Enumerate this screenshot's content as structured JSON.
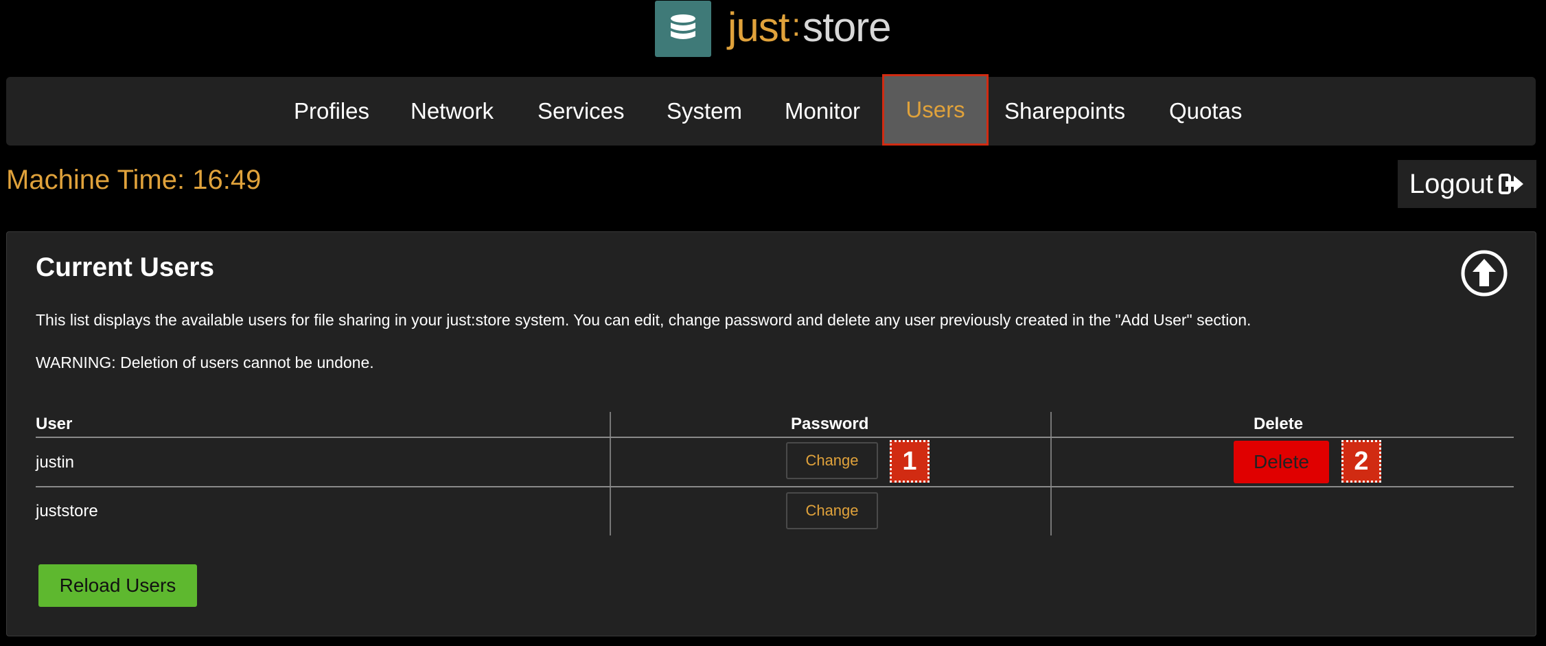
{
  "brand": {
    "just": "just",
    "colon": ":",
    "store": "store",
    "icon": "database-stack-icon",
    "icon_bg": "#3f7a78"
  },
  "nav": {
    "items": [
      {
        "label": "Profiles"
      },
      {
        "label": "Network"
      },
      {
        "label": "Services"
      },
      {
        "label": "System"
      },
      {
        "label": "Monitor"
      },
      {
        "label": "Users",
        "active": true
      },
      {
        "label": "Sharepoints"
      },
      {
        "label": "Quotas"
      }
    ]
  },
  "machine_time": "Machine Time: 16:49",
  "logout": {
    "label": "Logout",
    "icon": "sign-out-icon"
  },
  "panel": {
    "title": "Current Users",
    "description": "This list displays the available users for file sharing in your just:store system. You can edit, change password and delete any user previously created in the \"Add User\" section.",
    "warning": "WARNING: Deletion of users cannot be undone.",
    "collapse_icon": "arrow-up-circle-icon"
  },
  "table": {
    "headers": {
      "user": "User",
      "password": "Password",
      "delete": "Delete"
    },
    "rows": [
      {
        "user": "justin",
        "password_action": "Change",
        "delete_action": "Delete"
      },
      {
        "user": "juststore",
        "password_action": "Change"
      }
    ]
  },
  "annotations": {
    "badge1": "1",
    "badge2": "2"
  },
  "reload_label": "Reload Users",
  "colors": {
    "accent": "#e0a23b",
    "danger": "#e00000",
    "success": "#5eb82f",
    "highlight": "#d12b12"
  }
}
